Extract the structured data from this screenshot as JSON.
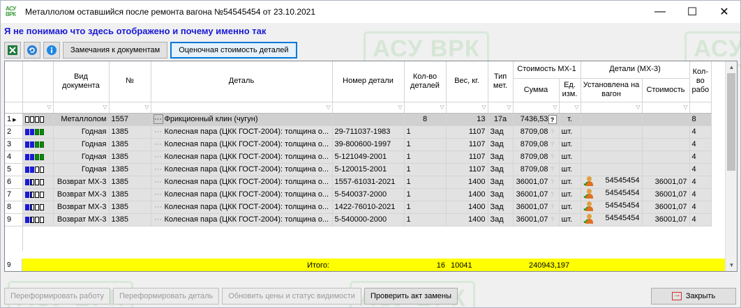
{
  "window": {
    "title": "Металлолом оставшийся после ремонта вагона №54545454 от 23.10.2021",
    "app_icon_text_top": "АСУ",
    "app_icon_text_bottom": "ВРК",
    "minimize": "—",
    "maximize": "☐",
    "close": "✕"
  },
  "watermark": "АСУ ВРК",
  "warning_text": "Я не понимаю что здесь отображено и почему именно так",
  "toolbar": {
    "excel_icon": "excel-icon",
    "refresh_icon": "refresh-icon",
    "info_icon": "info-icon",
    "remarks_label": "Замечания к документам",
    "estimate_label": "Оценочная стоимость деталей"
  },
  "columns": {
    "doc_type": "Вид документа",
    "number": "№",
    "detail": "Деталь",
    "detail_number": "Номер детали",
    "qty": "Кол-во деталей",
    "weight": "Вес, кг.",
    "metal_type": "Тип мет.",
    "cost_group": "Стоимость МХ-1",
    "sum": "Сумма",
    "unit": "Ед. изм.",
    "mx3_group": "Детали (МХ-3)",
    "installed": "Установлена на вагон",
    "cost": "Стоимость",
    "qty2": "Кол-во рабо"
  },
  "rows": [
    {
      "rn": "1",
      "status": "oooo",
      "doc": "Металлолом",
      "num": "1557",
      "detail": "Фрикционный клин (чугун)",
      "detnum": "",
      "qty": "8",
      "weight": "13",
      "metal": "17а",
      "sum": "7436,53",
      "unit": "т.",
      "installed": "",
      "cost": "",
      "qty2": "8"
    },
    {
      "rn": "2",
      "status": "bbgg",
      "doc": "Годная",
      "num": "1385",
      "detail": "Колесная пара (ЦКК ГОСТ-2004): толщина о...",
      "detnum": "29-711037-1983",
      "qty": "1",
      "weight": "1107",
      "metal": "Зад",
      "sum": "8709,08",
      "unit": "шт.",
      "installed": "",
      "cost": "",
      "qty2": "4"
    },
    {
      "rn": "3",
      "status": "bbgg",
      "doc": "Годная",
      "num": "1385",
      "detail": "Колесная пара (ЦКК ГОСТ-2004): толщина о...",
      "detnum": "39-800600-1997",
      "qty": "1",
      "weight": "1107",
      "metal": "Зад",
      "sum": "8709,08",
      "unit": "шт.",
      "installed": "",
      "cost": "",
      "qty2": "4"
    },
    {
      "rn": "4",
      "status": "bbgg",
      "doc": "Годная",
      "num": "1385",
      "detail": "Колесная пара (ЦКК ГОСТ-2004): толщина о...",
      "detnum": "5-121049-2001",
      "qty": "1",
      "weight": "1107",
      "metal": "Зад",
      "sum": "8709,08",
      "unit": "шт.",
      "installed": "",
      "cost": "",
      "qty2": "4"
    },
    {
      "rn": "5",
      "status": "bboo",
      "doc": "Годная",
      "num": "1385",
      "detail": "Колесная пара (ЦКК ГОСТ-2004): толщина о...",
      "detnum": "5-120015-2001",
      "qty": "1",
      "weight": "1107",
      "metal": "Зад",
      "sum": "8709,08",
      "unit": "шт.",
      "installed": "",
      "cost": "",
      "qty2": "4"
    },
    {
      "rn": "6",
      "status": "bhoo",
      "doc": "Возврат МХ-3",
      "num": "1385",
      "detail": "Колесная пара (ЦКК ГОСТ-2004): толщина о...",
      "detnum": "1557-61031-2021",
      "qty": "1",
      "weight": "1400",
      "metal": "Зад",
      "sum": "36001,07",
      "unit": "шт.",
      "installed": "54545454",
      "cost": "36001,07",
      "qty2": "4"
    },
    {
      "rn": "7",
      "status": "bhoo",
      "doc": "Возврат МХ-3",
      "num": "1385",
      "detail": "Колесная пара (ЦКК ГОСТ-2004): толщина о...",
      "detnum": "5-540037-2000",
      "qty": "1",
      "weight": "1400",
      "metal": "Зад",
      "sum": "36001,07",
      "unit": "шт.",
      "installed": "54545454",
      "cost": "36001,07",
      "qty2": "4"
    },
    {
      "rn": "8",
      "status": "bhoo",
      "doc": "Возврат МХ-3",
      "num": "1385",
      "detail": "Колесная пара (ЦКК ГОСТ-2004): толщина о...",
      "detnum": "1422-76010-2021",
      "qty": "1",
      "weight": "1400",
      "metal": "Зад",
      "sum": "36001,07",
      "unit": "шт.",
      "installed": "54545454",
      "cost": "36001,07",
      "qty2": "4"
    },
    {
      "rn": "9",
      "status": "bhoo",
      "doc": "Возврат МХ-3",
      "num": "1385",
      "detail": "Колесная пара (ЦКК ГОСТ-2004): толщина о...",
      "detnum": "5-540000-2000",
      "qty": "1",
      "weight": "1400",
      "metal": "Зад",
      "sum": "36001,07",
      "unit": "шт.",
      "installed": "54545454",
      "cost": "36001,07",
      "qty2": "4"
    }
  ],
  "total": {
    "rn": "9",
    "label": "Итого:",
    "qty": "16",
    "weight": "10041",
    "sum": "240943,197"
  },
  "bottom_buttons": {
    "reform_work": "Переформировать работу",
    "reform_detail": "Переформировать деталь",
    "update_prices": "Обновить цены и статус видимости",
    "check_act": "Проверить акт замены",
    "close": "Закрыть"
  },
  "colors": {
    "total_row": "#ffff00",
    "warning": "#1a1ad6",
    "active_border": "#0078d7"
  }
}
